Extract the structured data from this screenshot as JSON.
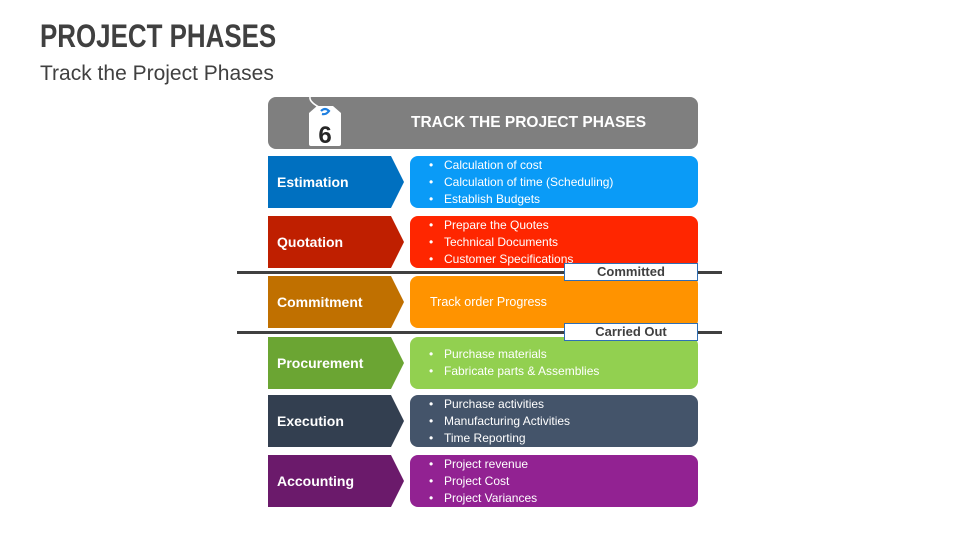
{
  "slide": {
    "title": "PROJECT PHASES",
    "subtitle": "Track the Project Phases"
  },
  "header": {
    "title": "TRACK THE PROJECT PHASES",
    "tag_number": "6",
    "tag_icon": "price-tag-icon",
    "color": "#7f7f7f"
  },
  "phases": [
    {
      "name": "Estimation",
      "color": "#0070c0",
      "box_color": "#0a9bf7",
      "items": [
        "Calculation of cost",
        "Calculation of time (Scheduling)",
        "Establish Budgets"
      ]
    },
    {
      "name": "Quotation",
      "color": "#bf1f00",
      "box_color": "#ff2600",
      "items": [
        "Prepare the Quotes",
        "Technical Documents",
        "Customer Specifications"
      ]
    },
    {
      "name": "Commitment",
      "color": "#c07000",
      "box_color": "#ff9300",
      "text": "Track order Progress"
    },
    {
      "name": "Procurement",
      "color": "#6ba533",
      "box_color": "#92d050",
      "items": [
        "Purchase materials",
        "Fabricate parts & Assemblies"
      ]
    },
    {
      "name": "Execution",
      "color": "#333f50",
      "box_color": "#44546a",
      "items": [
        "Purchase activities",
        "Manufacturing Activities",
        "Time Reporting"
      ]
    },
    {
      "name": "Accounting",
      "color": "#6b1a6b",
      "box_color": "#922292",
      "items": [
        "Project revenue",
        "Project Cost",
        "Project Variances"
      ]
    }
  ],
  "milestones": [
    {
      "label": "Committed"
    },
    {
      "label": "Carried Out"
    }
  ]
}
